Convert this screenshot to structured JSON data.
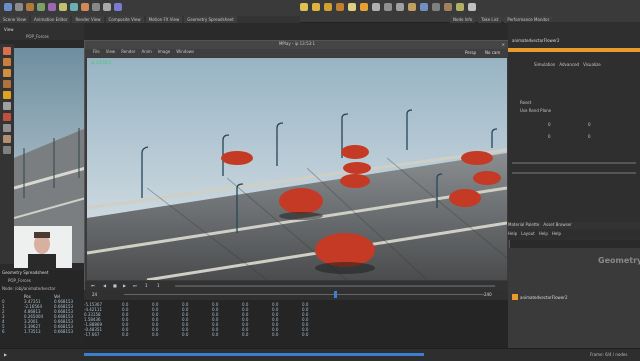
{
  "top_tabs": [
    "Scene View",
    "Animation Editor",
    "Render View",
    "Composite View",
    "Motion FX View",
    "Geometry Spreadsheet"
  ],
  "right_top_tabs": [
    "Node Info",
    "Take List",
    "Performance Monitor"
  ],
  "left_panel": {
    "tab": "View",
    "path": "POP_Forces"
  },
  "mplay": {
    "title": "MPlay - ip 13:53:1",
    "menu": [
      "File",
      "View",
      "Render",
      "Anim",
      "Image",
      "Windows"
    ],
    "frame_field": "ip 13:53:1",
    "mode_buttons": [
      "Persp",
      "No cam"
    ],
    "start_frame": "1",
    "end_frame": "1",
    "current_frame": "24",
    "timeline_end": "240",
    "playback_info": "24"
  },
  "right_panel": {
    "node_name": "animatedvectorFlower2",
    "subtabs": [
      "Simulation",
      "Advanced",
      "Visualize"
    ],
    "label_rows": [
      "Reset",
      "Use Rend Plane"
    ],
    "values": [
      "0",
      "0",
      "0",
      "0"
    ]
  },
  "network": {
    "tabs": [
      "Material Palette",
      "Asset Browser"
    ],
    "menu": [
      "Help",
      "Layout",
      "Help",
      "Help"
    ],
    "context_label": "Geometry",
    "node_label": "animatedvectorFlower2"
  },
  "spreadsheet": {
    "title": "Geometry Spreadsheet",
    "path": "POP_Forces",
    "node_label": "Node: /obj/animatedvector",
    "columns": [
      "Pos",
      "Vel"
    ],
    "rows": [
      [
        "0",
        "3.47351",
        "0.668153"
      ],
      [
        "1",
        "-2.16564",
        "0.668153"
      ],
      [
        "2",
        "4.86813",
        "0.668153"
      ],
      [
        "3",
        "0.265004",
        "0.668153"
      ],
      [
        "4",
        "3.2001",
        "0.668153"
      ],
      [
        "5",
        "3.39627",
        "0.668153"
      ],
      [
        "6",
        "1.73513",
        "0.668153"
      ]
    ],
    "extra_columns": [
      [
        "-5.15367",
        "0.0",
        "0.0",
        "0.0",
        "0.0",
        "0.0",
        "0.0",
        "0.0"
      ],
      [
        "-4.42111",
        "0.0",
        "0.0",
        "0.0",
        "0.0",
        "0.0",
        "0.0",
        "0.0"
      ],
      [
        "0.33158",
        "0.0",
        "0.0",
        "0.0",
        "0.0",
        "0.0",
        "0.0",
        "0.0"
      ],
      [
        "1.58436",
        "0.0",
        "0.0",
        "0.0",
        "0.0",
        "0.0",
        "0.0",
        "0.0"
      ],
      [
        "-1.88869",
        "0.0",
        "0.0",
        "0.0",
        "0.0",
        "0.0",
        "0.0",
        "0.0"
      ],
      [
        "-0.48351",
        "0.0",
        "0.0",
        "0.0",
        "0.0",
        "0.0",
        "0.0",
        "0.0"
      ],
      [
        "-17.667",
        "0.0",
        "0.0",
        "0.0",
        "0.0",
        "0.0",
        "0.0",
        "0.0"
      ]
    ]
  },
  "status": {
    "right": "Frame: 6/4 / nodes"
  },
  "colors": {
    "accent": "#e89b2a",
    "sky_top": "#9cb7c6",
    "sky_bottom": "#dfe6ea",
    "car": "#c43a24"
  }
}
